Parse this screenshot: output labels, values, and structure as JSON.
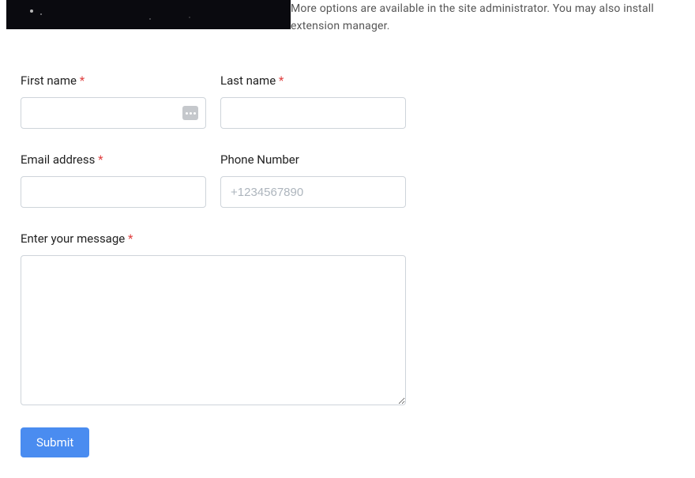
{
  "intro_text": "More options are available in the site administrator. You may also install extension manager.",
  "form": {
    "first_name": {
      "label": "First name",
      "required": true,
      "value": ""
    },
    "last_name": {
      "label": "Last name",
      "required": true,
      "value": ""
    },
    "email": {
      "label": "Email address",
      "required": true,
      "value": ""
    },
    "phone": {
      "label": "Phone Number",
      "required": false,
      "placeholder": "+1234567890",
      "value": ""
    },
    "message": {
      "label": "Enter your message",
      "required": true,
      "value": ""
    },
    "submit_label": "Submit",
    "required_marker": "*"
  }
}
